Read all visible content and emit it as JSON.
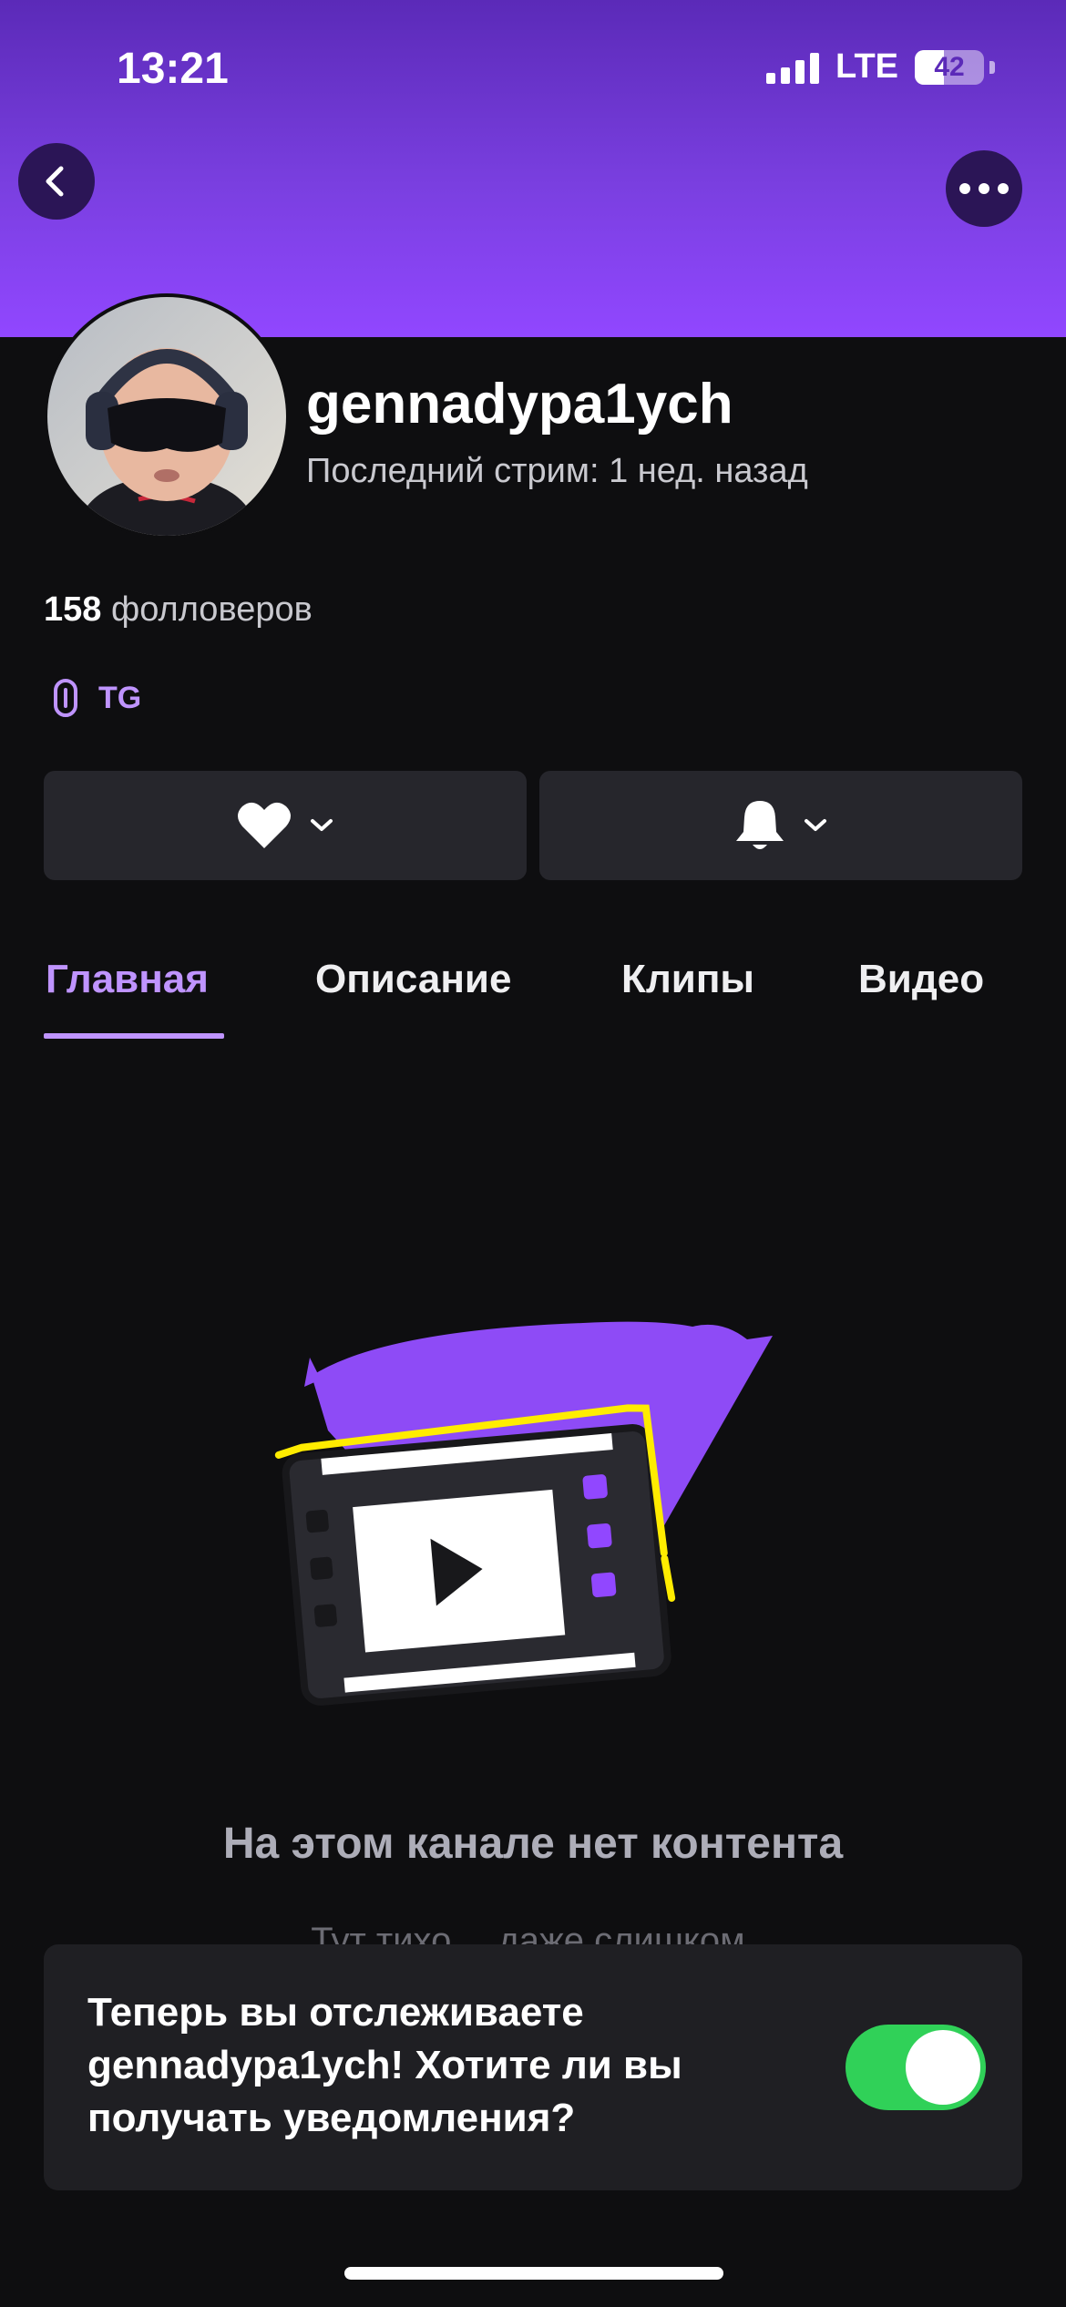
{
  "status_bar": {
    "time": "13:21",
    "network": "LTE",
    "battery": "42",
    "battery_level": 0.42
  },
  "channel": {
    "username": "gennadypa1ych",
    "last_stream": "Последний стрим: 1 нед. назад",
    "followers_count": "158",
    "followers_label": "фолловеров",
    "link_label": "TG"
  },
  "tabs": [
    {
      "label": "Главная",
      "active": true
    },
    {
      "label": "Описание",
      "active": false
    },
    {
      "label": "Клипы",
      "active": false
    },
    {
      "label": "Видео",
      "active": false
    }
  ],
  "empty_state": {
    "title": "На этом канале нет контента",
    "subtitle": "Тут тихо… даже слишком."
  },
  "toast": {
    "message": "Теперь вы отслеживаете gennadypa1ych! Хотите ли вы получать уведомления?",
    "toggle_on": true
  },
  "icons": {
    "back": "chevron-left-icon",
    "more": "more-horizontal-icon",
    "link": "link-icon",
    "follow": "heart-icon",
    "notifications": "bell-icon"
  },
  "colors": {
    "header_top": "#5b2ab8",
    "header_bottom": "#9147ff",
    "accent": "#bf94ff",
    "background": "#0e0e10",
    "toggle_on": "#30d158"
  }
}
